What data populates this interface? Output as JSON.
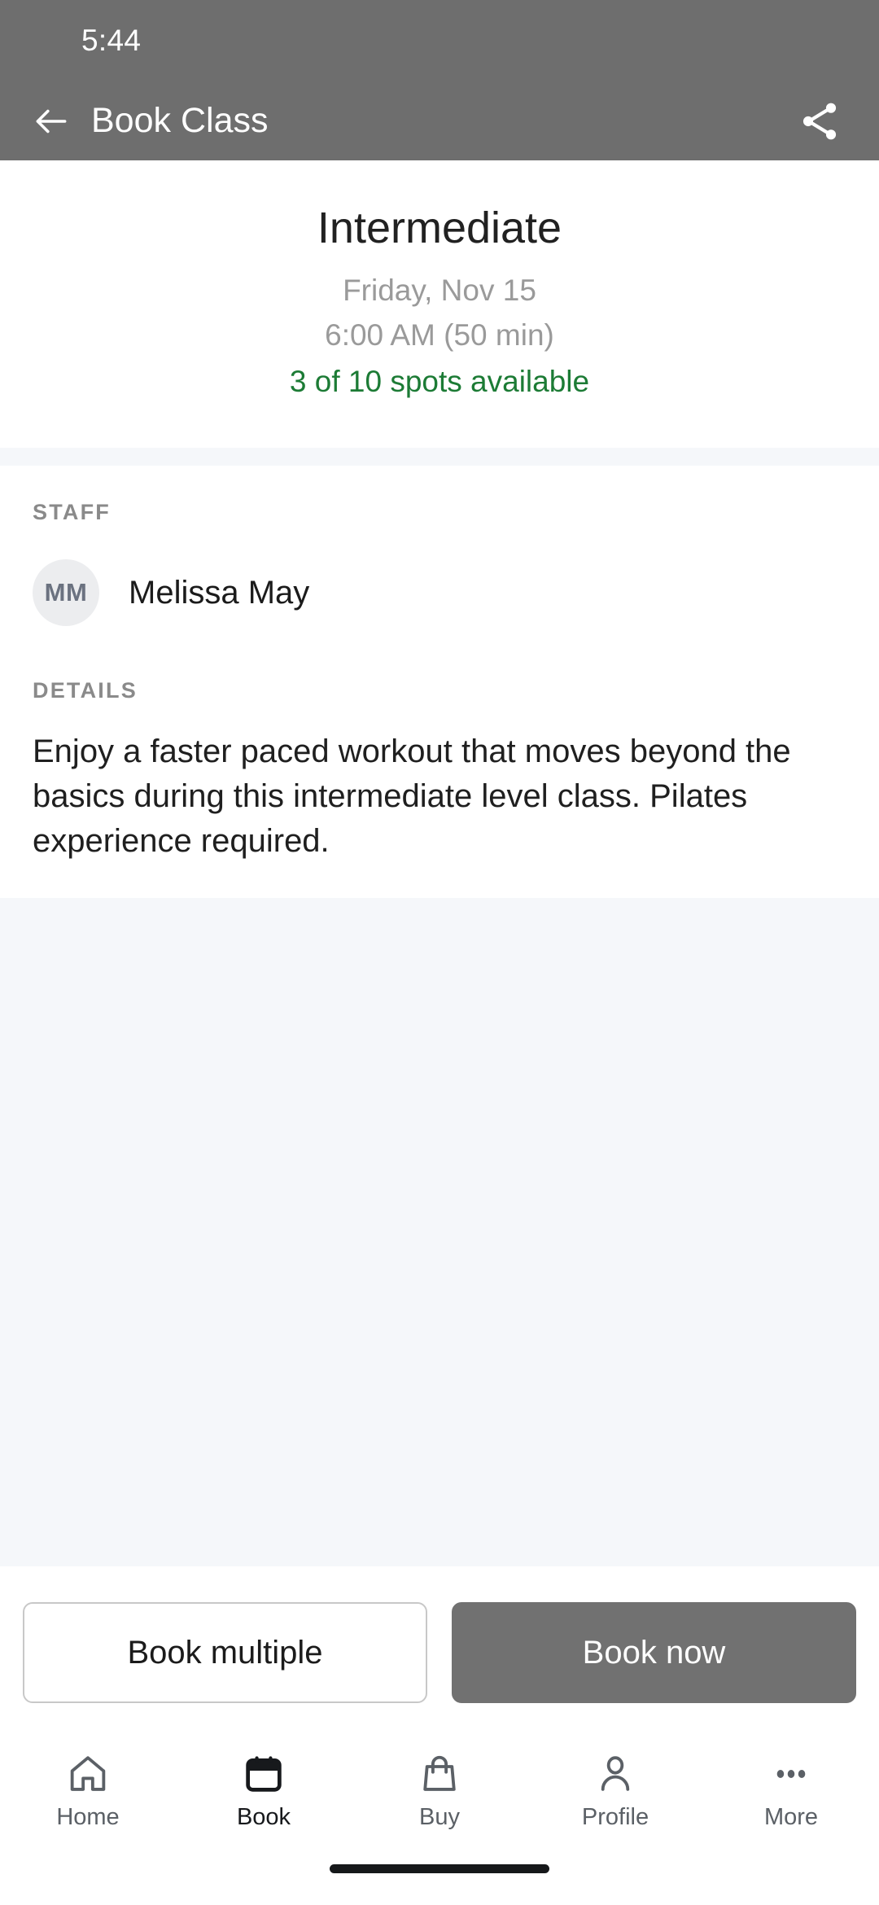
{
  "status_bar": {
    "time": "5:44"
  },
  "app_bar": {
    "title": "Book Class",
    "back_icon": "arrow-left-icon",
    "share_icon": "share-icon",
    "background_color": "#6e6e6e"
  },
  "class_summary": {
    "title": "Intermediate",
    "date": "Friday, Nov 15",
    "time": "6:00 AM (50 min)",
    "spots": "3 of 10 spots available",
    "spots_color": "#1c7b35"
  },
  "staff_section": {
    "label": "STAFF",
    "avatar_initials": "MM",
    "name": "Melissa May"
  },
  "details_section": {
    "label": "DETAILS",
    "text": "Enjoy a faster paced workout that moves beyond the basics during this intermediate level class. Pilates experience required."
  },
  "actions": {
    "secondary_label": "Book multiple",
    "primary_label": "Book now",
    "primary_color": "#717171"
  },
  "bottom_nav": {
    "items": [
      {
        "label": "Home",
        "icon": "home-icon",
        "active": false
      },
      {
        "label": "Book",
        "icon": "calendar-icon",
        "active": true
      },
      {
        "label": "Buy",
        "icon": "bag-icon",
        "active": false
      },
      {
        "label": "Profile",
        "icon": "person-icon",
        "active": false
      },
      {
        "label": "More",
        "icon": "ellipsis-icon",
        "active": false
      }
    ]
  }
}
